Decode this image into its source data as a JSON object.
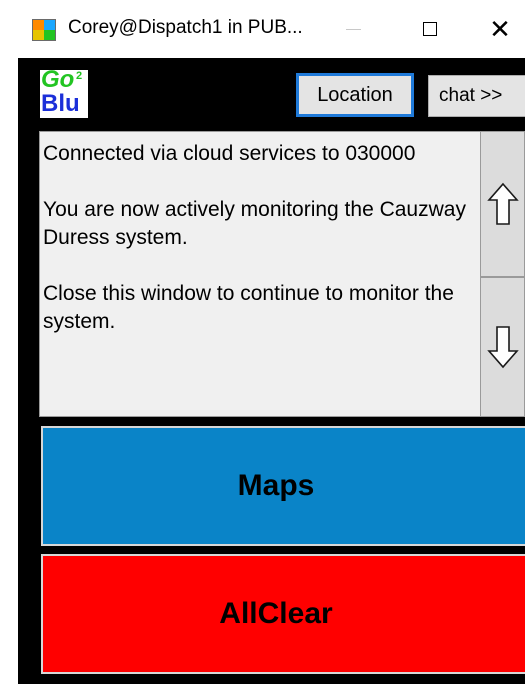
{
  "window": {
    "title": "Corey@Dispatch1 in PUB...",
    "minimize_glyph": "—",
    "maximize_glyph": "☐",
    "close_glyph": "✕"
  },
  "logo": {
    "go": "Go",
    "superscript": "2",
    "blu": "Blu"
  },
  "header": {
    "location_label": "Location",
    "chat_label": "chat >>"
  },
  "messages": [
    "Connected via cloud services to 030000",
    "You are now actively monitoring the Cauzway Duress system.",
    "Close this window to continue to monitor the system."
  ],
  "scroll": {
    "up_icon": "arrow-up-icon",
    "down_icon": "arrow-down-icon"
  },
  "actions": {
    "maps_label": "Maps",
    "allclear_label": "AllClear"
  },
  "colors": {
    "maps_bg": "#0a84c8",
    "allclear_bg": "#ff0000",
    "window_bg": "#000000",
    "location_border": "#1f7ad9"
  }
}
